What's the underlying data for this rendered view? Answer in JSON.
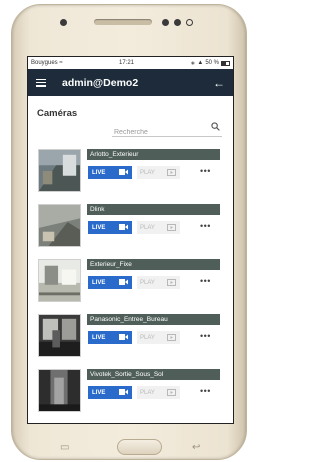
{
  "status": {
    "carrier": "Bouygues",
    "time": "17:21",
    "battery": "50 %"
  },
  "appbar": {
    "title": "admin@Demo2"
  },
  "page": {
    "title": "Caméras"
  },
  "search": {
    "placeholder": "Recherche"
  },
  "buttons": {
    "live": "LIVE",
    "play": "PLAY",
    "more": "•••"
  },
  "cameras": [
    {
      "name": "Arlotto_Exterieur"
    },
    {
      "name": "Dlink"
    },
    {
      "name": "Exterieur_Fixe"
    },
    {
      "name": "Panasonic_Entree_Bureau"
    },
    {
      "name": "Vivotek_Sortie_Sous_Sol"
    }
  ],
  "colors": {
    "appbar": "#1d2b3a",
    "camera_name_bar": "#4f5e58",
    "live_button": "#2a6acb",
    "play_button": "#f1f1f1"
  }
}
